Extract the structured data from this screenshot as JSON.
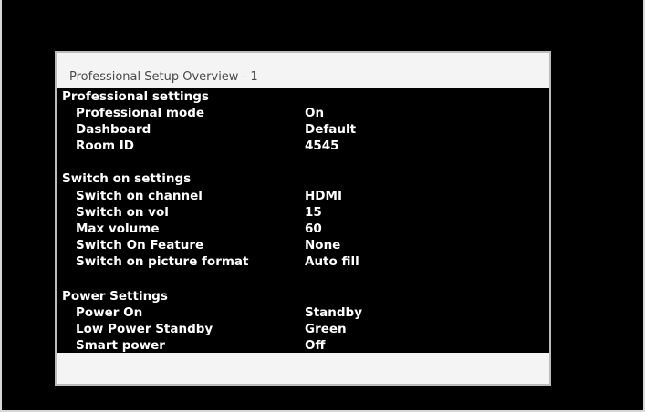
{
  "title": "Professional Setup Overview - 1",
  "sections": [
    {
      "heading": "Professional settings",
      "items": [
        {
          "label": "Professional mode",
          "value": "On"
        },
        {
          "label": "Dashboard",
          "value": "Default"
        },
        {
          "label": "Room ID",
          "value": "4545"
        }
      ]
    },
    {
      "heading": "Switch on settings",
      "items": [
        {
          "label": "Switch on channel",
          "value": "HDMI"
        },
        {
          "label": "Switch on vol",
          "value": "15"
        },
        {
          "label": "Max volume",
          "value": "60"
        },
        {
          "label": "Switch On Feature",
          "value": "None"
        },
        {
          "label": "Switch on picture format",
          "value": "Auto fill"
        }
      ]
    },
    {
      "heading": "Power Settings",
      "items": [
        {
          "label": "Power On",
          "value": "Standby"
        },
        {
          "label": "Low Power Standby",
          "value": "Green"
        },
        {
          "label": "Smart power",
          "value": "Off"
        }
      ]
    }
  ]
}
